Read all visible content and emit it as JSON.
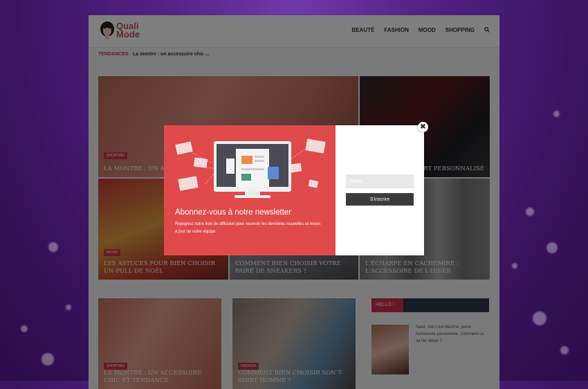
{
  "header": {
    "logo_line1": "Quali",
    "logo_line2": "Mode",
    "nav": [
      "BEAUTÉ",
      "FASHION",
      "MOOD",
      "SHOPPING"
    ]
  },
  "trending": {
    "label": "TENDANCES",
    "text": "La montre : un accessoire chic ..."
  },
  "grid": [
    {
      "tag": "SHOPPING",
      "title": "LA MONTRE : UN ACCESSOIRE CHIC ET TENDANCE"
    },
    {
      "tag": "",
      "title": "UN T-SHIRT PERSONNALISÉ"
    },
    {
      "tag": "MOOD",
      "title": "LES ASTUCES POUR BIEN CHOISIR UN PULL DE NOËL"
    },
    {
      "tag": "",
      "title": "COMMENT BIEN CHOISIR VOTRE PAIRE DE SNEAKERS ?"
    },
    {
      "tag": "",
      "title": "L'ÉCHARPE EN CACHEMIRE : L'ACCESSOIRE DE L'HIVER"
    }
  ],
  "lower": [
    {
      "tag": "SHOPPING",
      "title": "LA MONTRE : UN ACCESSOIRE CHIC ET TENDANCE"
    },
    {
      "tag": "FASHION",
      "title": "COMMENT BIEN CHOISIR SON T-SHIRT HOMME ?"
    }
  ],
  "widget": {
    "title": "HELLO !",
    "text": "Salut, moi c'est Martine, jeune fashionista passionnée. Comment ça va fait début ?"
  },
  "popup": {
    "title": "Abonnez-vous à notre newsletter",
    "subtitle": "Rejoignez notre liste de diffusion pour recevoir les dernières nouvelles et mises à jour de notre équipe.",
    "email_placeholder": "Email",
    "button": "S'inscrire",
    "close": "✖",
    "accent": "#e04a4a"
  }
}
